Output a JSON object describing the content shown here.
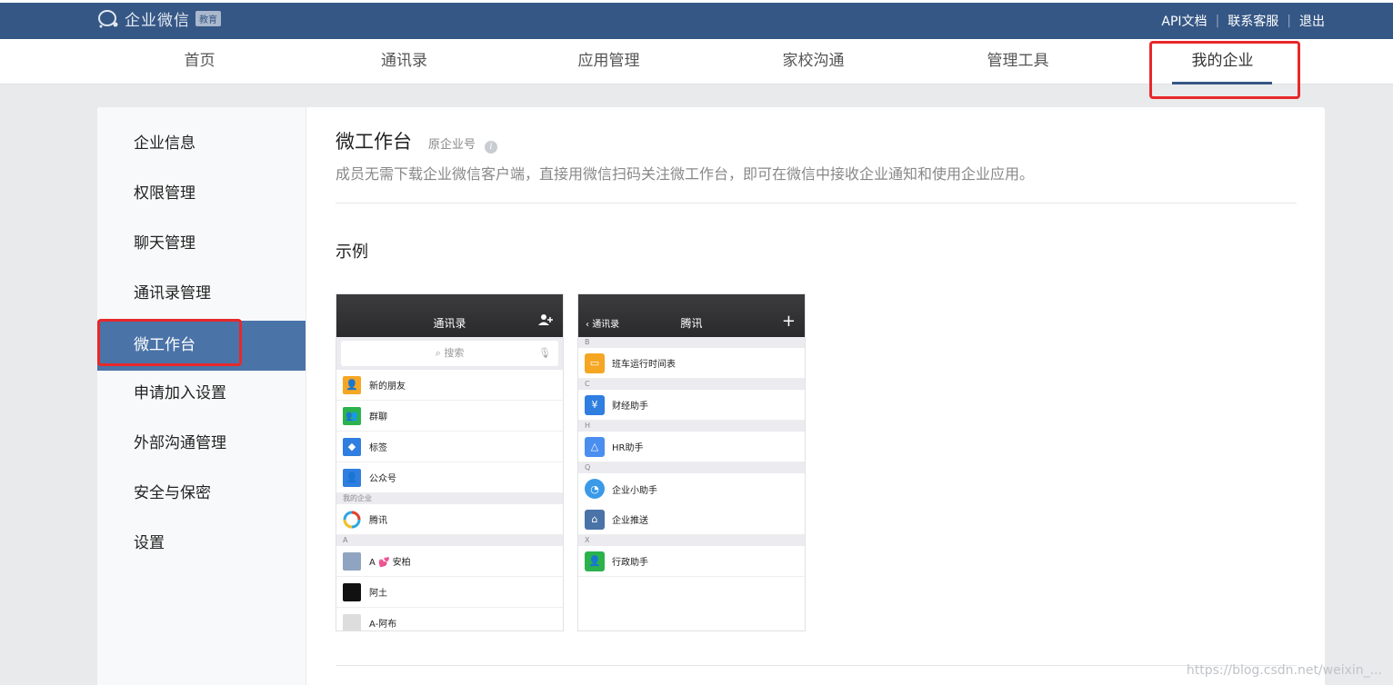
{
  "header": {
    "logo_text": "企业微信",
    "logo_badge": "教育",
    "links": [
      "API文档",
      "联系客服",
      "退出"
    ]
  },
  "nav": {
    "items": [
      "首页",
      "通讯录",
      "应用管理",
      "家校沟通",
      "管理工具",
      "我的企业"
    ],
    "active": "我的企业"
  },
  "sidebar": {
    "items": [
      "企业信息",
      "权限管理",
      "聊天管理",
      "通讯录管理",
      "微工作台",
      "申请加入设置",
      "外部沟通管理",
      "安全与保密",
      "设置"
    ],
    "active": "微工作台"
  },
  "main": {
    "title": "微工作台",
    "subtag": "原企业号",
    "info_icon": "i",
    "description": "成员无需下载企业微信客户端，直接用微信扫码关注微工作台，即可在微信中接收企业通知和使用企业应用。",
    "section_title": "示例"
  },
  "phone1": {
    "title": "通讯录",
    "search_placeholder": "搜索",
    "rows_top": [
      "新的朋友",
      "群聊",
      "标签",
      "公众号"
    ],
    "group_my": "我的企业",
    "company": "腾讯",
    "group_a": "A",
    "contacts": [
      "A 💕 安柏",
      "阿土",
      "A-阿布"
    ]
  },
  "phone2": {
    "back": "通讯录",
    "title": "腾讯",
    "sections": [
      {
        "letter": "B",
        "items": [
          "班车运行时间表"
        ]
      },
      {
        "letter": "C",
        "items": [
          "财经助手"
        ]
      },
      {
        "letter": "H",
        "items": [
          "HR助手"
        ]
      },
      {
        "letter": "Q",
        "items": [
          "企业小助手",
          "企业推送"
        ]
      },
      {
        "letter": "X",
        "items": [
          "行政助手"
        ]
      }
    ]
  },
  "watermark": "https://blog.csdn.net/weixin_...",
  "colors": {
    "topbar": "#355785",
    "sidebar_active": "#4a73a8",
    "highlight_box": "#e8282a"
  }
}
